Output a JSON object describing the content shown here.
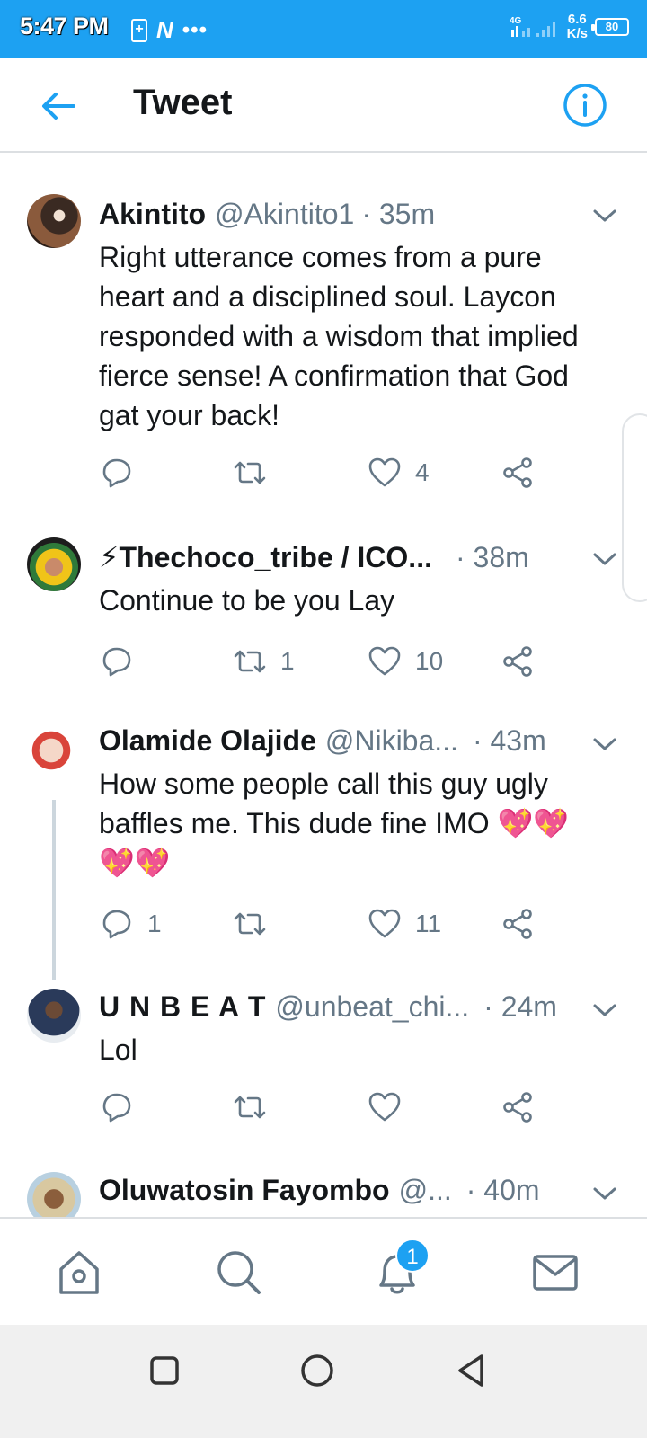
{
  "status_bar": {
    "time": "5:47 PM",
    "left_icons": [
      "battery-saver-icon",
      "n-app-icon",
      "more-dots-icon"
    ],
    "network_label": "4G",
    "speed_value": "6.6",
    "speed_unit": "K/s",
    "battery": "80"
  },
  "header": {
    "title": "Tweet",
    "back_icon": "back-arrow-icon",
    "info_icon": "info-icon"
  },
  "colors": {
    "accent": "#1da1f2",
    "text_primary": "#14171a",
    "text_secondary": "#657786",
    "like_red": "#e0245e"
  },
  "tweets": [
    {
      "name": "Akintito",
      "handle": "@Akintito1",
      "time": "· 35m",
      "text": "Right utterance comes from a pure heart and a disciplined soul. Laycon responded with a wisdom that implied fierce sense! A confirmation that God gat your back!",
      "replies": "",
      "retweets": "",
      "likes": "4"
    },
    {
      "name": "⚡Thechoco_tribe / ICO...",
      "handle": "",
      "time": "· 38m",
      "text": "Continue to be you Lay",
      "replies": "",
      "retweets": "1",
      "likes": "10"
    },
    {
      "name": "Olamide Olajide",
      "handle": "@Nikiba...",
      "time": "· 43m",
      "text_line1": "How some people call this guy ugly",
      "text_line2": "baffles me. This dude fine IMO",
      "emoji": "💖",
      "replies": "1",
      "retweets": "",
      "likes": "11"
    },
    {
      "name": "U N B E A T",
      "handle": "@unbeat_chi...",
      "time": "· 24m",
      "text": "Lol",
      "replies": "",
      "retweets": "",
      "likes": ""
    },
    {
      "name": "Oluwatosin Fayombo",
      "handle": "@...",
      "time": "· 40m"
    }
  ],
  "bottom_nav": {
    "items": [
      "home-icon",
      "search-icon",
      "notifications-icon",
      "messages-icon"
    ],
    "notification_badge": "1"
  },
  "system_nav": [
    "recents-square-icon",
    "home-circle-icon",
    "back-triangle-icon"
  ]
}
